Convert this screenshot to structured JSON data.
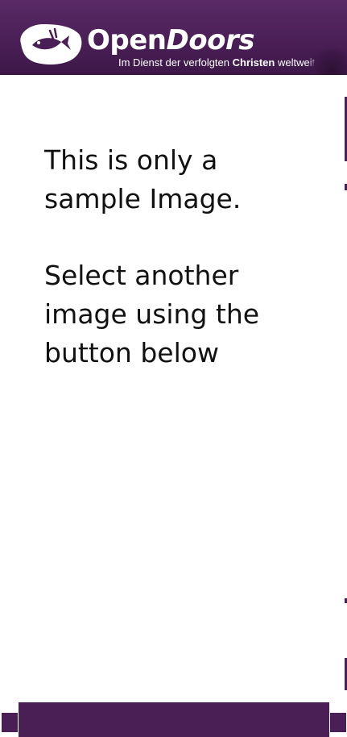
{
  "banner": {
    "brand_first": "Open",
    "brand_second": "Doors",
    "tagline_prefix": "Im Dienst der verfolgten ",
    "tagline_bold": "Christen",
    "tagline_suffix": " weltweit",
    "logo_icon": "fish-logo-icon"
  },
  "message": {
    "line1": "This is only a",
    "line2": "sample Image.",
    "line3": "Select another",
    "line4": "image using the",
    "line5": "button below"
  },
  "colors": {
    "brand_purple": "#4a1f56",
    "banner_top": "#5a2a66",
    "text": "#111111",
    "background": "#ffffff"
  }
}
